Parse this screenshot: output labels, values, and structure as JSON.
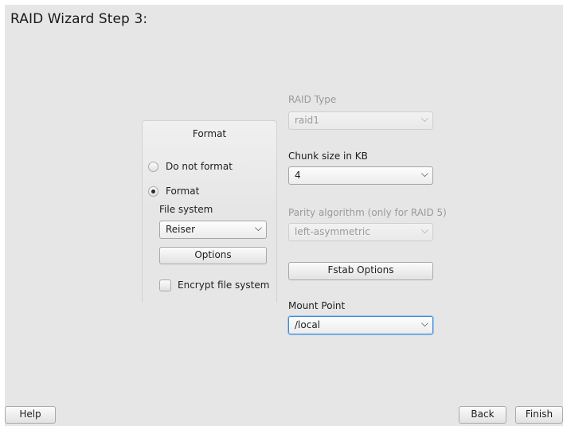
{
  "dialog": {
    "title": "RAID Wizard Step 3:"
  },
  "format_group": {
    "title": "Format",
    "do_not_format_label": "Do not format",
    "format_label": "Format",
    "format_selected": true,
    "file_system_label": "File system",
    "file_system_value": "Reiser",
    "options_button": "Options",
    "encrypt_label": "Encrypt file system",
    "encrypt_checked": false
  },
  "raid": {
    "type_label": "RAID Type",
    "type_value": "raid1",
    "chunk_label": "Chunk size in KB",
    "chunk_value": "4",
    "parity_label": "Parity algorithm (only for RAID 5)",
    "parity_value": "left-asymmetric",
    "fstab_button": "Fstab Options",
    "mount_label": "Mount Point",
    "mount_value": "/local"
  },
  "footer": {
    "help": "Help",
    "back": "Back",
    "finish": "Finish"
  },
  "icons": {
    "dropdown": "chevron-down-icon"
  }
}
